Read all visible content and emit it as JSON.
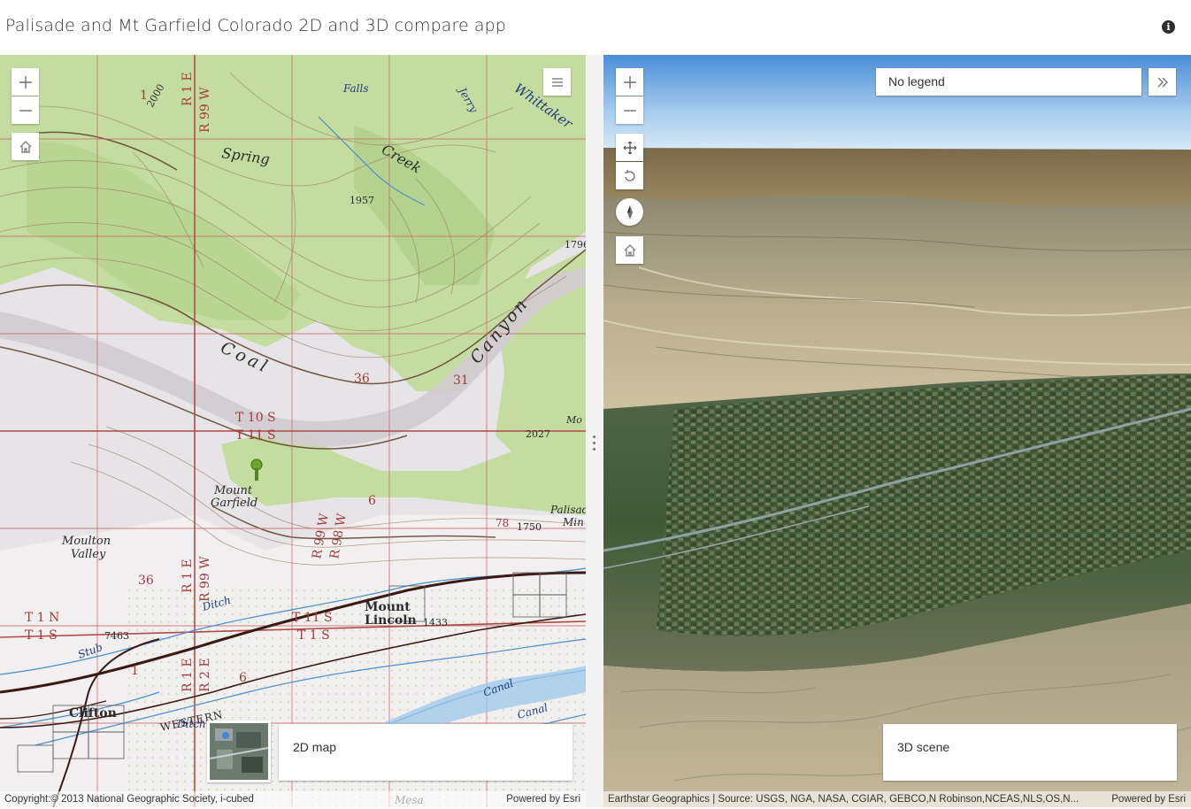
{
  "app": {
    "title": "Palisade and Mt Garfield Colorado 2D and 3D compare app"
  },
  "left_map": {
    "label": "2D map",
    "attribution": "Copyright:© 2013 National Geographic Society, i-cubed",
    "powered_by": "Powered by Esri",
    "places": [
      "Falls",
      "Jerry",
      "Whittaker",
      "Spring",
      "Creek",
      "1957",
      "Coal",
      "Canyon",
      "36",
      "31",
      "T 10 S",
      "T 11 S",
      "Mount",
      "Garfield",
      "2027",
      "Palisade",
      "Min",
      "Moulton",
      "Valley",
      "36",
      "R 1 E",
      "R 99 W",
      "R 99 W",
      "R 98 W",
      "R 1 E",
      "R 99 W",
      "T 1 N",
      "T 1 S",
      "Ditch",
      "Stub",
      "7463",
      "Ditch",
      "R 1 E",
      "R 2 E",
      "6",
      "1",
      "T 11 S",
      "T 1 S",
      "Mount",
      "Lincoln",
      "1433",
      "Clifton",
      "WESTERN",
      "Canal",
      "Canal",
      "1",
      "6",
      "1750",
      "78",
      "1796",
      "Mesa",
      "Mo"
    ]
  },
  "right_scene": {
    "label": "3D scene",
    "legend_text": "No legend",
    "attribution": "Earthstar Geographics | Source: USGS, NGA, NASA, CGIAR, GEBCO,N Robinson,NCEAS,NLS,OS,N...",
    "powered_by": "Powered by Esri"
  },
  "icons": [
    "zoom-in-icon",
    "zoom-out-icon",
    "home-icon",
    "layer-list-icon",
    "pan-icon",
    "rotate-icon",
    "compass-icon",
    "expand-icon",
    "info-icon"
  ]
}
